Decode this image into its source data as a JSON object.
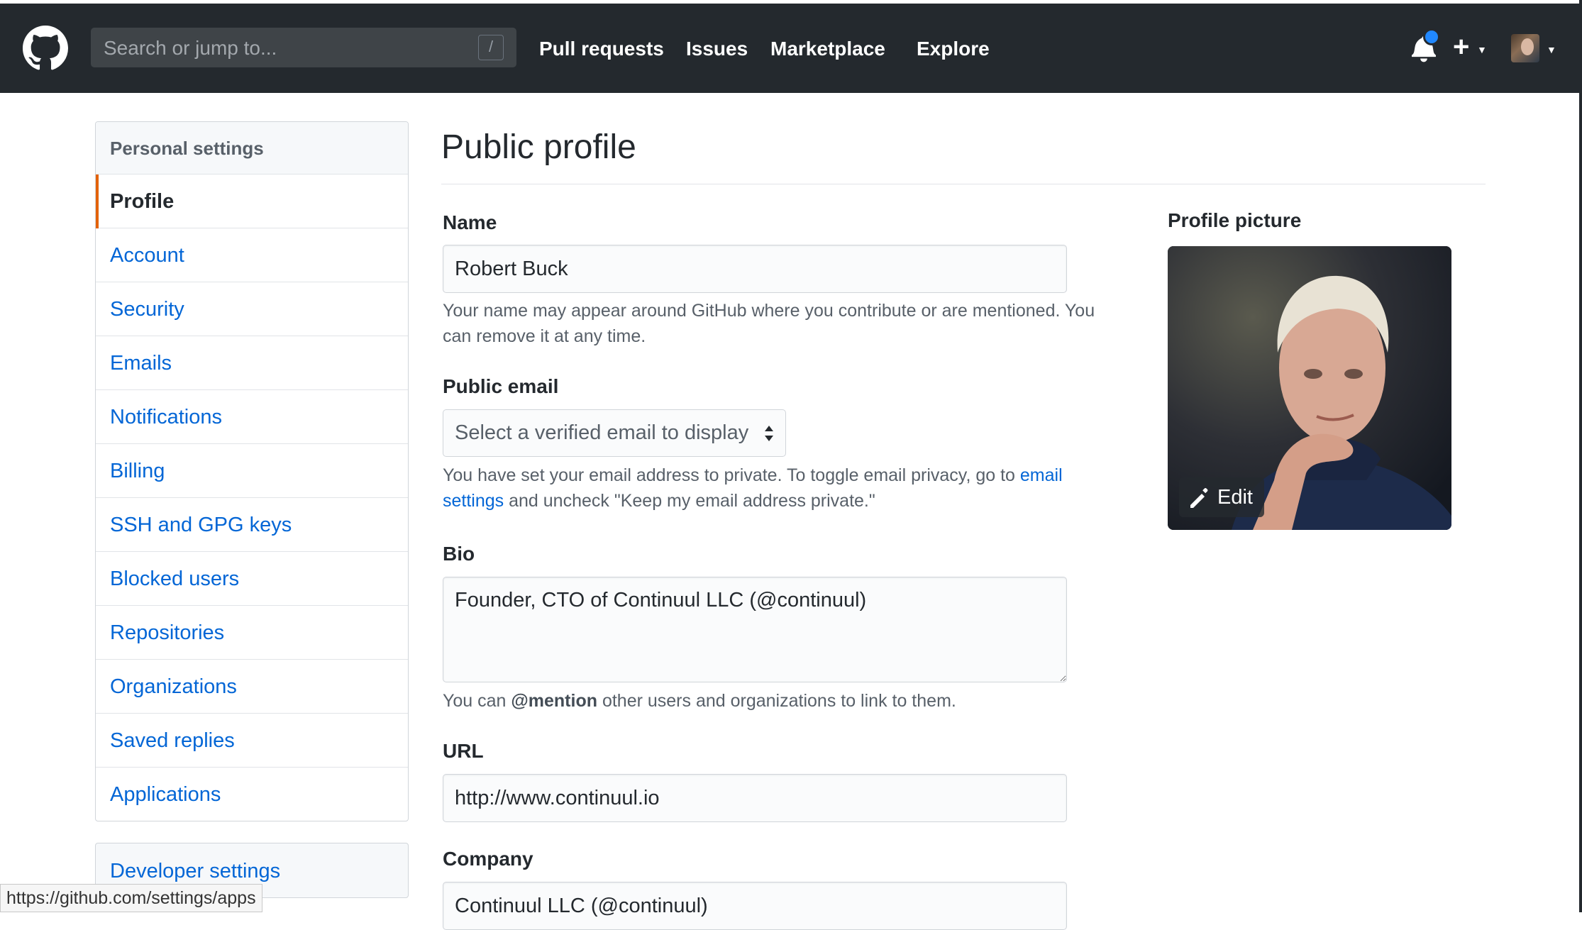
{
  "header": {
    "search_placeholder": "Search or jump to...",
    "search_shortcut": "/",
    "nav": [
      "Pull requests",
      "Issues",
      "Marketplace",
      "Explore"
    ],
    "colors": {
      "bar": "#24292e",
      "notification_dot": "#2188ff"
    }
  },
  "sidebar": {
    "title": "Personal settings",
    "items": [
      {
        "label": "Profile",
        "selected": true
      },
      {
        "label": "Account"
      },
      {
        "label": "Security"
      },
      {
        "label": "Emails"
      },
      {
        "label": "Notifications"
      },
      {
        "label": "Billing"
      },
      {
        "label": "SSH and GPG keys"
      },
      {
        "label": "Blocked users"
      },
      {
        "label": "Repositories"
      },
      {
        "label": "Organizations"
      },
      {
        "label": "Saved replies"
      },
      {
        "label": "Applications"
      }
    ],
    "developer_settings": "Developer settings"
  },
  "status_url": "https://github.com/settings/apps",
  "main": {
    "title": "Public profile",
    "name": {
      "label": "Name",
      "value": "Robert Buck",
      "help": "Your name may appear around GitHub where you contribute or are mentioned. You can remove it at any time."
    },
    "public_email": {
      "label": "Public email",
      "selected": "Select a verified email to display",
      "help_before": "You have set your email address to private. To toggle email privacy, go to ",
      "help_link": "email settings",
      "help_after": " and uncheck \"Keep my email address private.\""
    },
    "bio": {
      "label": "Bio",
      "value": "Founder, CTO of Continuul LLC (@continuul)",
      "help_before": "You can ",
      "help_mention": "@mention",
      "help_after": " other users and organizations to link to them."
    },
    "url": {
      "label": "URL",
      "value": "http://www.continuul.io"
    },
    "company": {
      "label": "Company",
      "value": "Continuul LLC (@continuul)"
    },
    "profile_picture": {
      "label": "Profile picture",
      "edit_label": "Edit"
    }
  }
}
